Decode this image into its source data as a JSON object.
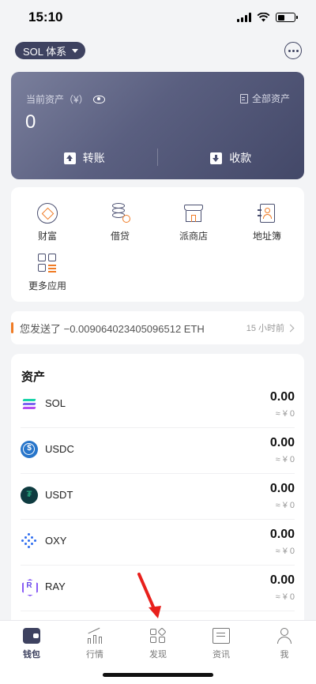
{
  "status": {
    "time": "15:10"
  },
  "header": {
    "chain_label": "SOL 体系",
    "more_icon": "more-dots-icon"
  },
  "asset_card": {
    "label": "当前资产（¥）",
    "all_assets": "全部资产",
    "value": "0",
    "transfer": "转账",
    "receive": "收款"
  },
  "apps": [
    {
      "label": "财富",
      "icon": "wealth-icon"
    },
    {
      "label": "借贷",
      "icon": "loan-icon"
    },
    {
      "label": "派商店",
      "icon": "shop-icon"
    },
    {
      "label": "地址簿",
      "icon": "address-book-icon"
    },
    {
      "label": "更多应用",
      "icon": "more-apps-icon"
    }
  ],
  "notice": {
    "text": "您发送了 −0.009064023405096512 ETH",
    "time": "15 小时前"
  },
  "assets": {
    "title": "资产",
    "tokens": [
      {
        "name": "SOL",
        "amount": "0.00",
        "fiat": "≈ ¥ 0"
      },
      {
        "name": "USDC",
        "amount": "0.00",
        "fiat": "≈ ¥ 0"
      },
      {
        "name": "USDT",
        "amount": "0.00",
        "fiat": "≈ ¥ 0"
      },
      {
        "name": "OXY",
        "amount": "0.00",
        "fiat": "≈ ¥ 0"
      },
      {
        "name": "RAY",
        "amount": "0.00",
        "fiat": "≈ ¥ 0"
      }
    ]
  },
  "tabbar": {
    "tabs": [
      {
        "label": "钱包",
        "active": true
      },
      {
        "label": "行情",
        "active": false
      },
      {
        "label": "发现",
        "active": false
      },
      {
        "label": "资讯",
        "active": false
      },
      {
        "label": "我",
        "active": false
      }
    ]
  },
  "colors": {
    "accent": "#3e4260",
    "highlight": "#f07b25",
    "arrow": "#e8201c"
  }
}
